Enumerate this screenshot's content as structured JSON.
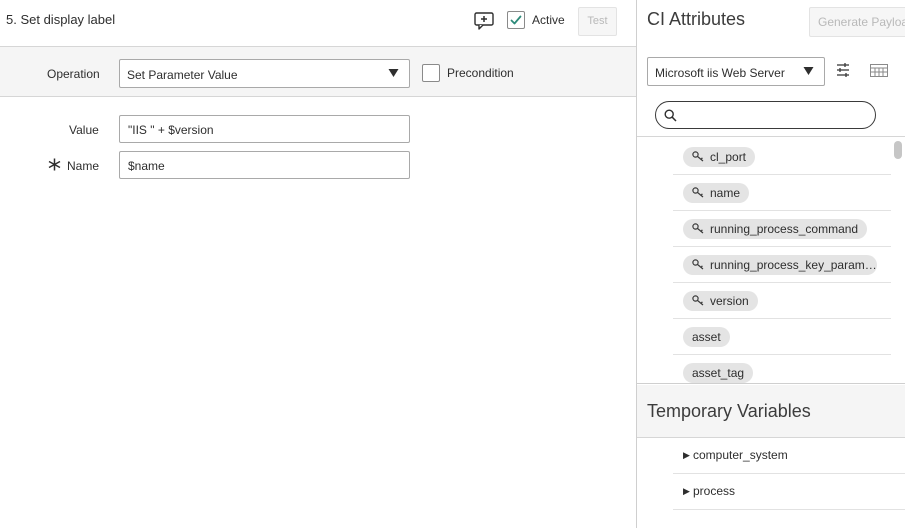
{
  "step": {
    "title": "5. Set display label",
    "active_label": "Active",
    "active_checked": true,
    "test_label": "Test"
  },
  "operation": {
    "label": "Operation",
    "value": "Set Parameter Value",
    "precondition_label": "Precondition",
    "precondition_checked": false
  },
  "fields": {
    "value_label": "Value",
    "value_text": "\"IIS \" + $version",
    "name_label": "Name",
    "name_text": "$name",
    "name_required": true
  },
  "ci_panel": {
    "title": "CI Attributes",
    "generate_payload_label": "Generate Payload",
    "ci_type": "Microsoft iis Web Server",
    "search_placeholder": "",
    "attributes": [
      {
        "label": "cl_port",
        "key": true
      },
      {
        "label": "name",
        "key": true
      },
      {
        "label": "running_process_command",
        "key": true
      },
      {
        "label": "running_process_key_param…",
        "key": true
      },
      {
        "label": "version",
        "key": true
      },
      {
        "label": "asset",
        "key": false
      },
      {
        "label": "asset_tag",
        "key": false
      }
    ]
  },
  "temp_vars": {
    "title": "Temporary Variables",
    "items": [
      {
        "label": "computer_system"
      },
      {
        "label": "process"
      }
    ]
  },
  "colors": {
    "accent_check": "#2e8b7a",
    "chip_bg": "#e4e4e4",
    "panel_bg": "#f5f5f5"
  }
}
